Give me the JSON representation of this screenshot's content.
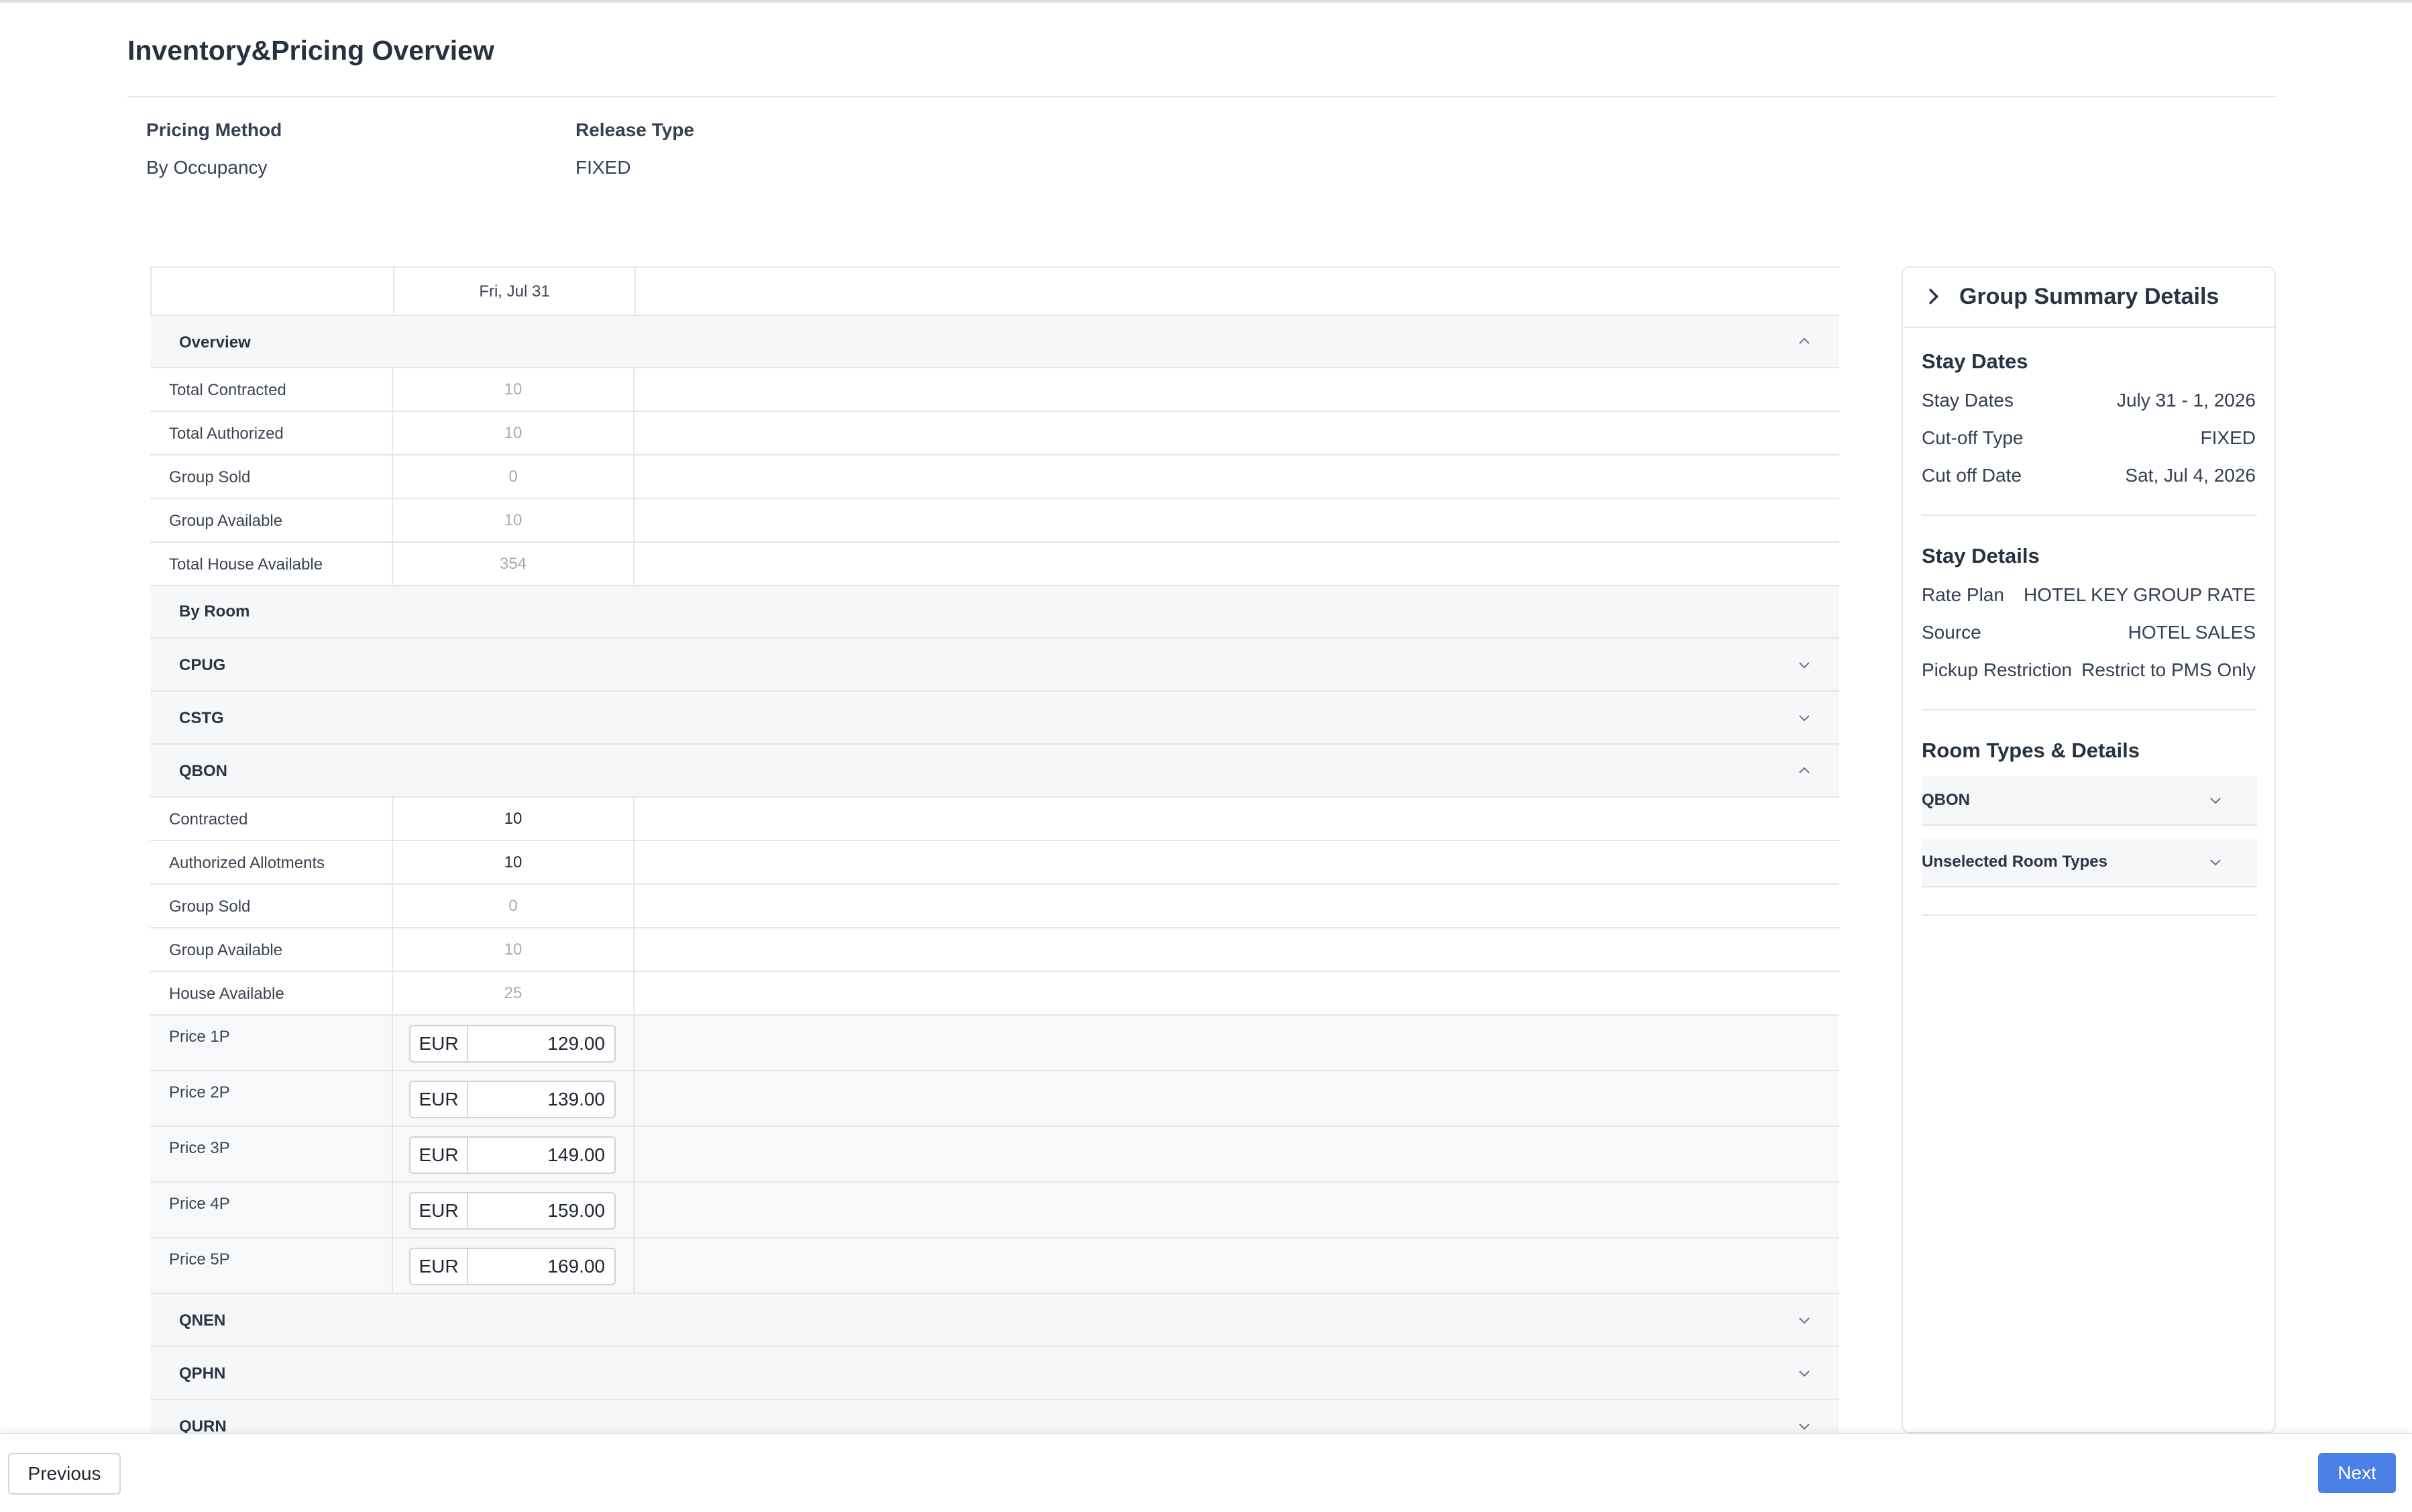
{
  "page": {
    "title": "Inventory&Pricing Overview"
  },
  "meta": {
    "pricing_method_label": "Pricing Method",
    "pricing_method_value": "By Occupancy",
    "release_type_label": "Release Type",
    "release_type_value": "FIXED"
  },
  "grid": {
    "date_header": "Fri, Jul 31",
    "overview": {
      "label": "Overview",
      "rows": [
        {
          "label": "Total Contracted",
          "value": "10"
        },
        {
          "label": "Total Authorized",
          "value": "10"
        },
        {
          "label": "Group Sold",
          "value": "0"
        },
        {
          "label": "Group Available",
          "value": "10"
        },
        {
          "label": "Total House Available",
          "value": "354"
        }
      ]
    },
    "by_room_label": "By Room",
    "rooms": {
      "cpug": "CPUG",
      "cstg": "CSTG",
      "qbon": {
        "label": "QBON",
        "rows": [
          {
            "label": "Contracted",
            "value": "10"
          },
          {
            "label": "Authorized Allotments",
            "value": "10"
          },
          {
            "label": "Group Sold",
            "value": "0"
          },
          {
            "label": "Group Available",
            "value": "10"
          },
          {
            "label": "House Available",
            "value": "25"
          }
        ],
        "prices": [
          {
            "label": "Price 1P",
            "currency": "EUR",
            "value": "129.00"
          },
          {
            "label": "Price 2P",
            "currency": "EUR",
            "value": "139.00"
          },
          {
            "label": "Price 3P",
            "currency": "EUR",
            "value": "149.00"
          },
          {
            "label": "Price 4P",
            "currency": "EUR",
            "value": "159.00"
          },
          {
            "label": "Price 5P",
            "currency": "EUR",
            "value": "169.00"
          }
        ]
      },
      "qnen": "QNEN",
      "qphn": "QPHN",
      "qurn": "QURN"
    }
  },
  "summary": {
    "title": "Group Summary Details",
    "stay_dates_heading": "Stay Dates",
    "stay_dates": [
      {
        "k": "Stay Dates",
        "v": "July 31 - 1, 2026"
      },
      {
        "k": "Cut-off Type",
        "v": "FIXED"
      },
      {
        "k": "Cut off Date",
        "v": "Sat, Jul 4, 2026"
      }
    ],
    "stay_details_heading": "Stay Details",
    "stay_details": [
      {
        "k": "Rate Plan",
        "v": "HOTEL KEY GROUP RATE"
      },
      {
        "k": "Source",
        "v": "HOTEL SALES"
      },
      {
        "k": "Pickup Restriction",
        "v": "Restrict to PMS Only"
      }
    ],
    "room_types_heading": "Room Types & Details",
    "room_types": [
      "QBON",
      "Unselected Room Types"
    ]
  },
  "footer": {
    "previous": "Previous",
    "next": "Next"
  },
  "icons": {
    "chevron_up": "chevron-up-icon",
    "chevron_down": "chevron-down-icon",
    "chevron_right": "chevron-right-icon"
  },
  "colors": {
    "accent": "#4a7fe8",
    "border": "#e3e6ea",
    "section_bg": "#f6f7f9"
  }
}
